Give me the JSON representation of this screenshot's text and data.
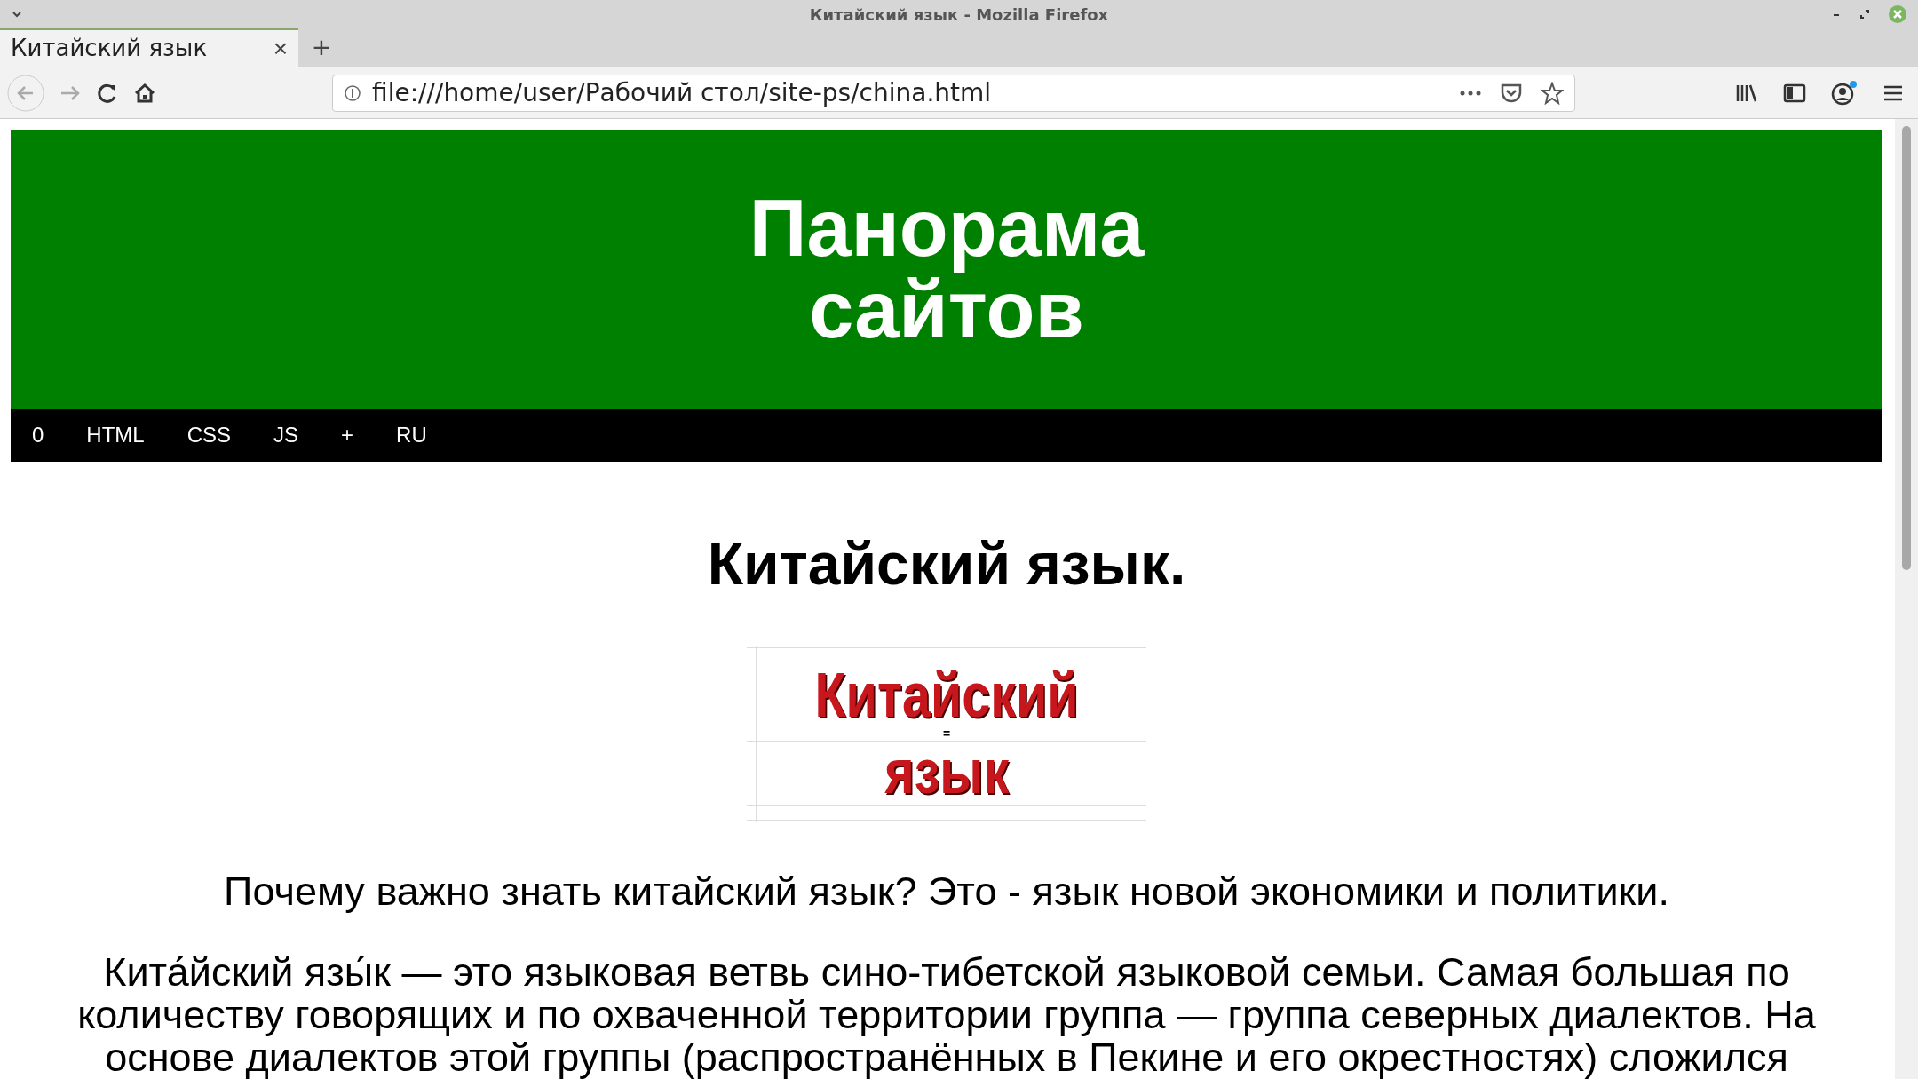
{
  "window": {
    "title": "Китайский язык - Mozilla Firefox"
  },
  "tabs": [
    {
      "label": "Китайский язык",
      "selected": true,
      "close": "×"
    }
  ],
  "new_tab": "+",
  "address_bar": {
    "value": "file:///home/user/Рабочий стол/site-ps/china.html"
  },
  "page": {
    "header": {
      "title_lines": [
        "Панорама",
        "сайтов"
      ]
    },
    "nav": [
      {
        "label": "0"
      },
      {
        "label": "HTML"
      },
      {
        "label": "CSS"
      },
      {
        "label": "JS"
      },
      {
        "label": "+"
      },
      {
        "label": "RU"
      }
    ],
    "heading": "Китайский язык.",
    "banner": {
      "lines": [
        "Китайский",
        "=",
        "язык"
      ]
    },
    "lead": "Почему важно знать китайский язык? Это - язык новой экономики и политики.",
    "body": "Кита́йский язы́к — это языковая ветвь сино-тибетской языковой семьи. Самая большая по количеству говорящих и по охваченной территории группа — группа северных диалектов. На основе диалектов этой группы (распространённых в Пекине и его окрестностях) сложился"
  }
}
